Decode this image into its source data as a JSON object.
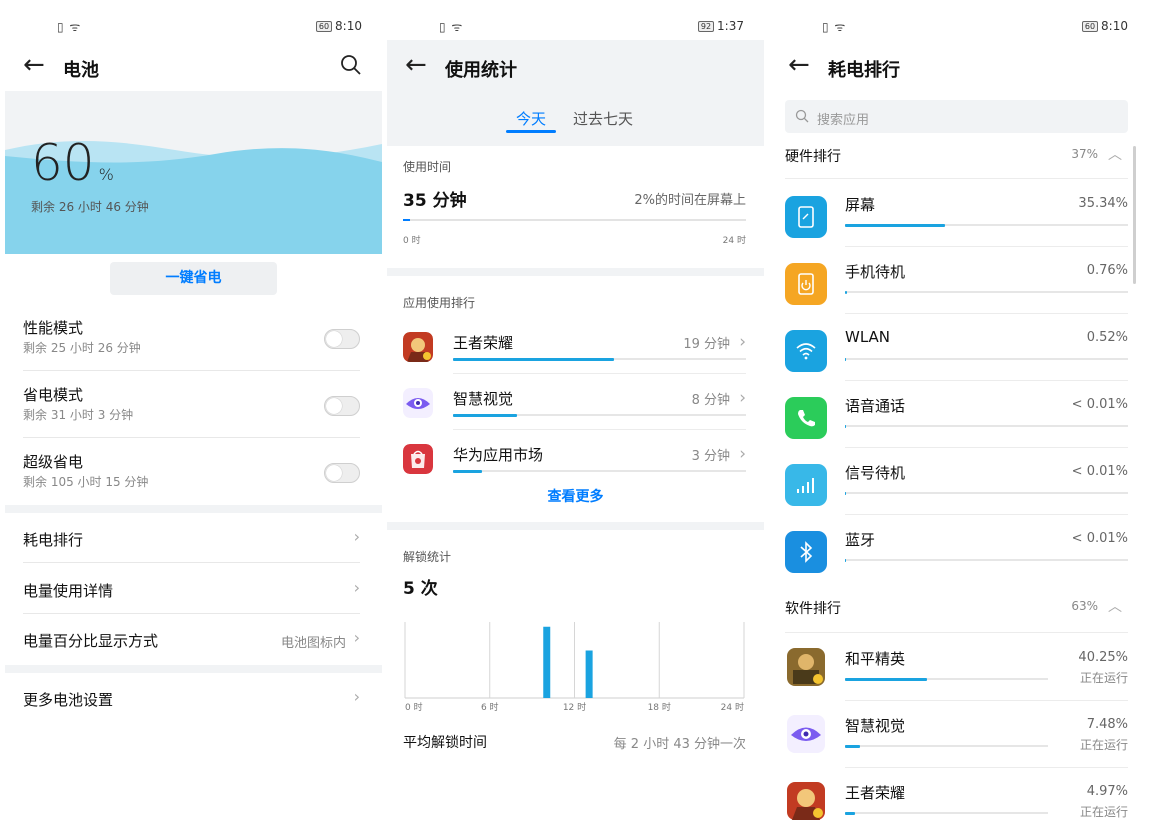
{
  "p1": {
    "status": {
      "icons": "▯ ᯤ",
      "battery": "60",
      "time": "8:10"
    },
    "title": "电池",
    "percent": "60",
    "percent_unit": "%",
    "remaining": "剩余 26 小时 46 分钟",
    "one_key": "一键省电",
    "modes": [
      {
        "name": "性能模式",
        "sub": "剩余 25 小时 26 分钟",
        "on": false
      },
      {
        "name": "省电模式",
        "sub": "剩余 31 小时 3 分钟",
        "on": false
      },
      {
        "name": "超级省电",
        "sub": "剩余 105 小时 15 分钟",
        "on": false
      }
    ],
    "links": [
      {
        "name": "耗电排行"
      },
      {
        "name": "电量使用详情"
      },
      {
        "name": "电量百分比显示方式",
        "value": "电池图标内"
      }
    ],
    "more": "更多电池设置",
    "colors": {
      "wave": "#86d3ec",
      "accent": "#007dff"
    }
  },
  "p2": {
    "status": {
      "icons": "▯ ᯤ",
      "battery": "92",
      "time": "1:37"
    },
    "title": "使用统计",
    "tabs": [
      "今天",
      "过去七天"
    ],
    "usage": {
      "label": "使用时间",
      "value": "35 分钟",
      "note": "2%的时间在屏幕上",
      "start": "0 时",
      "end": "24 时",
      "fraction": 0.02
    },
    "ranking_label": "应用使用排行",
    "apps": [
      {
        "name": "王者荣耀",
        "time": "19 分钟",
        "fraction": 0.55
      },
      {
        "name": "智慧视觉",
        "time": "8 分钟",
        "fraction": 0.22
      },
      {
        "name": "华为应用市场",
        "time": "3 分钟",
        "fraction": 0.1
      }
    ],
    "more": "查看更多",
    "unlock": {
      "label": "解锁统计",
      "value": "5 次",
      "avg_label": "平均解锁时间",
      "avg_value": "每 2 小时 43 分钟一次"
    },
    "chart_data": {
      "type": "bar",
      "title": "",
      "xlabel": "",
      "ylabel": "",
      "x_ticks": [
        "0 时",
        "6 时",
        "12 时",
        "18 时",
        "24 时"
      ],
      "xlim": [
        0,
        24
      ],
      "bars": [
        {
          "hour": 10,
          "value": 3
        },
        {
          "hour": 13,
          "value": 2
        }
      ],
      "ylim": [
        0,
        3.2
      ],
      "grid": "vertical"
    }
  },
  "p3": {
    "status": {
      "icons": "▯ ᯤ",
      "battery": "60",
      "time": "8:10"
    },
    "title": "耗电排行",
    "search_placeholder": "搜索应用",
    "hardware": {
      "label": "硬件排行",
      "value": "37%",
      "items": [
        {
          "name": "屏幕",
          "value": "35.34%",
          "fraction": 0.353,
          "icon": "screen-icon",
          "color": "#1aa3e0"
        },
        {
          "name": "手机待机",
          "value": "0.76%",
          "fraction": 0.008,
          "icon": "standby-icon",
          "color": "#f5a623"
        },
        {
          "name": "WLAN",
          "value": "0.52%",
          "fraction": 0.005,
          "icon": "wifi-icon",
          "color": "#1aa3e0"
        },
        {
          "name": "语音通话",
          "value": "< 0.01%",
          "fraction": 0.001,
          "icon": "phone-icon",
          "color": "#2bcc5a"
        },
        {
          "name": "信号待机",
          "value": "< 0.01%",
          "fraction": 0.001,
          "icon": "signal-icon",
          "color": "#38b8e8"
        },
        {
          "name": "蓝牙",
          "value": "< 0.01%",
          "fraction": 0.001,
          "icon": "bluetooth-icon",
          "color": "#1a8fe0"
        }
      ]
    },
    "software": {
      "label": "软件排行",
      "value": "63%",
      "items": [
        {
          "name": "和平精英",
          "value": "40.25%",
          "status": "正在运行",
          "fraction": 0.4
        },
        {
          "name": "智慧视觉",
          "value": "7.48%",
          "status": "正在运行",
          "fraction": 0.075
        },
        {
          "name": "王者荣耀",
          "value": "4.97%",
          "status": "正在运行",
          "fraction": 0.05
        }
      ]
    }
  }
}
